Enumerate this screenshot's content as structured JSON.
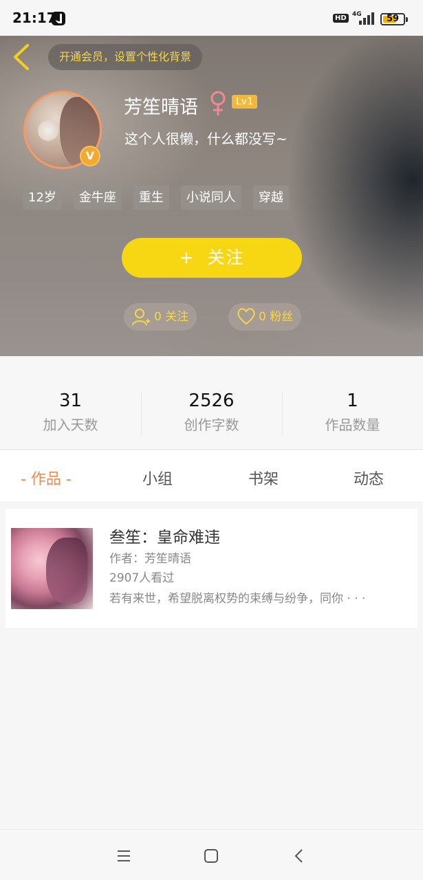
{
  "status_bar": {
    "time": "21:17",
    "network": "4G",
    "hd": "HD",
    "battery": "59"
  },
  "header": {
    "vip_prompt": "开通会员，设置个性化背景",
    "username": "芳笙晴语",
    "level": "Lv1",
    "bio": "这个人很懒，什么都没写~",
    "tags": [
      "12岁",
      "金牛座",
      "重生",
      "小说同人",
      "穿越"
    ],
    "follow_button": {
      "plus": "+",
      "label": "关注"
    },
    "following": "0 关注",
    "fans": "0 粉丝",
    "verified_badge": "V"
  },
  "stats": [
    {
      "value": "31",
      "label": "加入天数"
    },
    {
      "value": "2526",
      "label": "创作字数"
    },
    {
      "value": "1",
      "label": "作品数量"
    }
  ],
  "tabs": [
    "- 作品 -",
    "小组",
    "书架",
    "动态"
  ],
  "works": [
    {
      "title": "叁笙：皇命难违",
      "author": "作者：芳笙晴语",
      "views": "2907人看过",
      "summary": "若有来世，希望脱离权势的束缚与纷争，同你 · · ·"
    }
  ],
  "icons": {
    "back": "chevron-left-icon",
    "gender": "female-icon",
    "follow_stat": "person-add-icon",
    "fans_stat": "heart-icon"
  },
  "colors": {
    "accent": "#ef8a4f",
    "follow_button": "#f7d714",
    "gold_text": "#f6d64a"
  }
}
